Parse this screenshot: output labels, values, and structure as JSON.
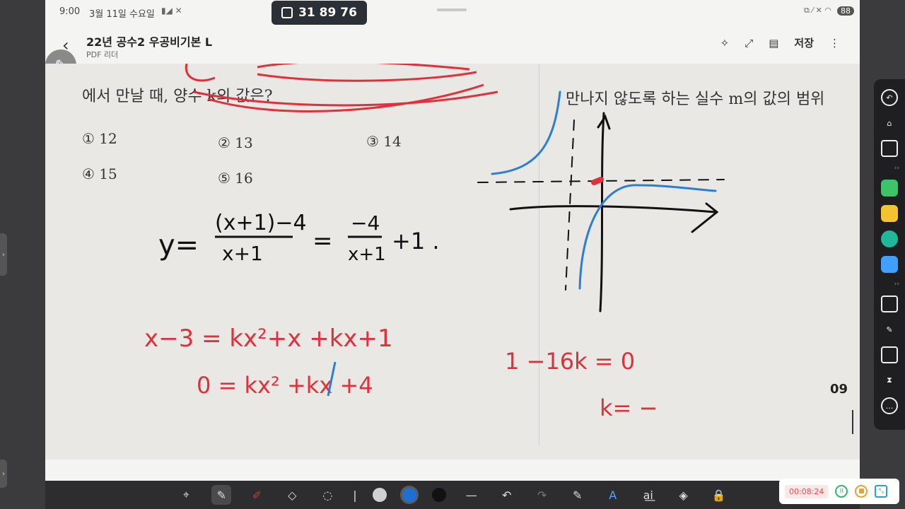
{
  "status": {
    "time": "9:00",
    "date": "3월 11일 수요일",
    "sys_icons": "▮◢ ✕",
    "battery": "88",
    "right_icons": "⧉ ⁄ ✕ ◠"
  },
  "share_code": {
    "code": "31 89 76",
    "icon": "share-screen-icon"
  },
  "app": {
    "back": "‹",
    "title": "22년 공수2 우공비기본 L",
    "subtitle": "PDF 리더",
    "actions": {
      "magic": "✧",
      "expand": "⤢",
      "doc": "▤",
      "save": "저장",
      "more": "⋮"
    }
  },
  "pen_fab": "✎",
  "doc": {
    "prompt": "에서 만날 때, 양수 k의 값은?",
    "choices": [
      {
        "label": "① 12"
      },
      {
        "label": "② 13"
      },
      {
        "label": "③ 14"
      },
      {
        "label": "④ 15"
      },
      {
        "label": "⑤ 16"
      }
    ],
    "right_prompt": "만나지 않도록 하는 실수 m의 값의 범위",
    "page_number": "09",
    "handwriting": {
      "black_eq_lhs": "y=",
      "black_num": "(x+1)−4",
      "black_den": "x+1",
      "black_eq2": "=",
      "black_num2": "−4",
      "black_den2": "x+1",
      "black_tail": "+1 .",
      "red_line1": "x−3 = kx²+x +kx+1",
      "red_line2": "0 = kx² +kx +4",
      "red_line3": "1 −16k = 0",
      "red_line4": "k= −"
    }
  },
  "toolbar": {
    "tools": [
      "⌖",
      "✎",
      "✐",
      "◇",
      "◌",
      "|",
      "",
      "",
      "",
      "—",
      "↶",
      "↷",
      "✎",
      "A",
      "a͟i",
      "◈",
      "🔒"
    ]
  },
  "colors": {
    "red_ink": "#e0303a",
    "blue_ink": "#2a7fd4",
    "black_ink": "#111111",
    "dot_gray": "#d0d0d0",
    "dot_blue": "#1f6fd0",
    "dot_black": "#111111"
  },
  "sidebar": {
    "items": [
      "back-icon",
      "home-icon",
      "window-icon",
      "green-app-icon",
      "notes-app-icon",
      "teal-app-icon",
      "apps-grid-icon",
      "screen-icon",
      "pen-icon",
      "layers-icon",
      "timer-icon",
      "more-icon"
    ]
  },
  "recorder": {
    "time": "00:08:24"
  }
}
